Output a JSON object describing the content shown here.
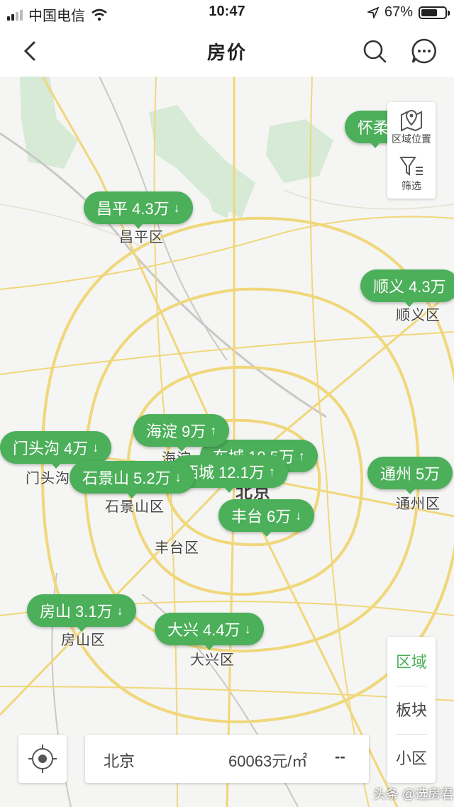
{
  "status_bar": {
    "carrier": "中国电信",
    "time": "10:47",
    "battery": "67%"
  },
  "nav": {
    "title": "房价"
  },
  "map_controls": {
    "region_position": "区域位置",
    "filter": "筛选"
  },
  "level_switcher": [
    "区域",
    "板块",
    "小区"
  ],
  "districts": [
    "昌平区",
    "顺义区",
    "门头沟",
    "海淀",
    "石景山区",
    "丰台区",
    "北京",
    "通州区",
    "房山区",
    "大兴区"
  ],
  "bubbles": [
    {
      "name": "怀柔",
      "price": "",
      "trend": "down"
    },
    {
      "name": "昌平",
      "price": "4.3万",
      "trend": "down"
    },
    {
      "name": "顺义",
      "price": "4.3万",
      "trend": "down"
    },
    {
      "name": "海淀",
      "price": "9万",
      "trend": "up"
    },
    {
      "name": "东城",
      "price": "10.5万",
      "trend": "up"
    },
    {
      "name": "门头沟",
      "price": "4万",
      "trend": "down"
    },
    {
      "name": "西城",
      "price": "12.1万",
      "trend": "up"
    },
    {
      "name": "石景山",
      "price": "5.2万",
      "trend": "down"
    },
    {
      "name": "通州",
      "price": "5万",
      "trend": "down"
    },
    {
      "name": "丰台",
      "price": "6万",
      "trend": "down"
    },
    {
      "name": "房山",
      "price": "3.1万",
      "trend": "down"
    },
    {
      "name": "大兴",
      "price": "4.4万",
      "trend": "down"
    }
  ],
  "bottom_card": {
    "city": "北京",
    "price": "60063元/㎡",
    "change": "--"
  },
  "watermark": "头条 @选房君",
  "colors": {
    "accent": "#4caf5a",
    "road": "#f2d97c",
    "park": "#cfe7cf"
  }
}
